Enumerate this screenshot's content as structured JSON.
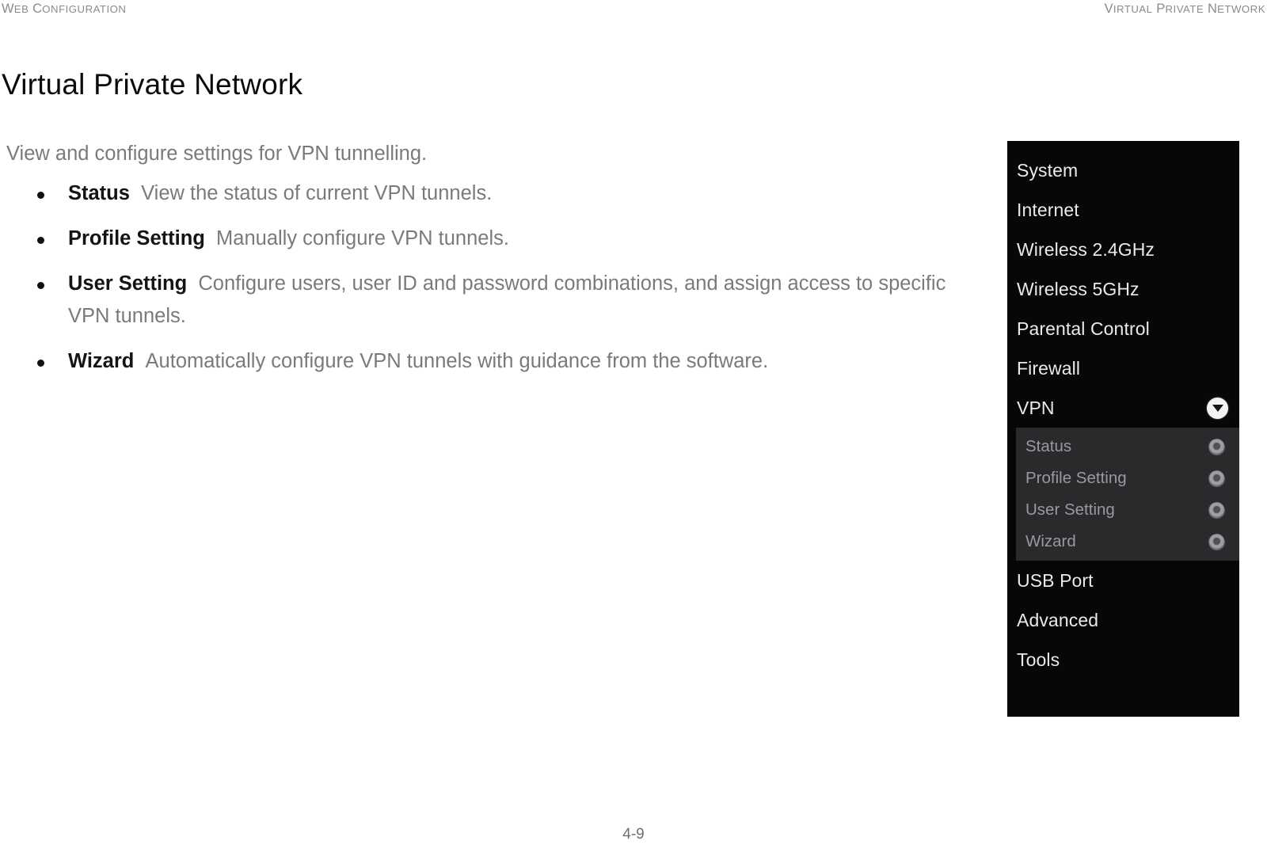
{
  "header": {
    "left_title": "WEB CONFIGURATION",
    "left_title_first": "W",
    "left_title_rest": "EB ",
    "left_title_first2": "C",
    "left_title_rest2": "ONFIGURATION",
    "right_title": "VIRTUAL PRIVATE NETWORK"
  },
  "page": {
    "title": "Virtual Private Network",
    "number": "4-9"
  },
  "content": {
    "intro": "View and configure settings for VPN tunnelling.",
    "bullets": [
      {
        "term": "Status",
        "desc": "View the status of current VPN tunnels."
      },
      {
        "term": "Profile Setting",
        "desc": "Manually configure VPN tunnels."
      },
      {
        "term": "User Setting",
        "desc": "Configure users, user ID and password combinations, and assign access to specific VPN tunnels."
      },
      {
        "term": "Wizard",
        "desc": "Automatically configure VPN tunnels with guidance from the software."
      }
    ]
  },
  "menu": {
    "items": [
      {
        "label": "System",
        "expanded": false
      },
      {
        "label": "Internet",
        "expanded": false
      },
      {
        "label": "Wireless 2.4GHz",
        "expanded": false
      },
      {
        "label": "Wireless 5GHz",
        "expanded": false
      },
      {
        "label": "Parental Control",
        "expanded": false
      },
      {
        "label": "Firewall",
        "expanded": false
      },
      {
        "label": "VPN",
        "expanded": true,
        "icon": "chevron-down-icon"
      },
      {
        "label": "USB Port",
        "expanded": false
      },
      {
        "label": "Advanced",
        "expanded": false
      },
      {
        "label": "Tools",
        "expanded": false
      }
    ],
    "submenu": {
      "parent": "VPN",
      "items": [
        {
          "label": "Status",
          "icon": "radio-dot-icon"
        },
        {
          "label": "Profile Setting",
          "icon": "radio-dot-icon"
        },
        {
          "label": "User Setting",
          "icon": "radio-dot-icon"
        },
        {
          "label": "Wizard",
          "icon": "radio-dot-icon"
        }
      ]
    }
  },
  "colors": {
    "panel_background": "#070707",
    "submenu_background": "#2a2a2c",
    "menu_text": "#e9e9ee",
    "submenu_text": "#9a9a9e",
    "body_text": "#7a7a7a",
    "term_text": "#141414",
    "header_text": "#8a8a8a"
  }
}
